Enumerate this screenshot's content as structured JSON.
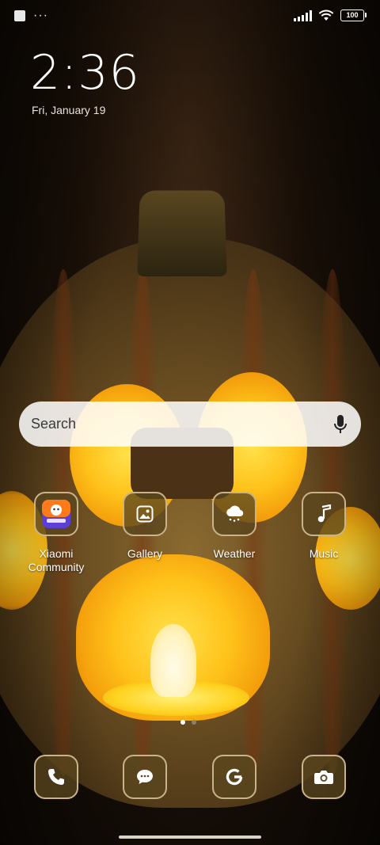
{
  "status_bar": {
    "notification_icon": "square-icon",
    "more_indicator": "···",
    "battery_level": "100",
    "signal": "cellular-signal-icon",
    "wifi": "wifi-icon"
  },
  "clock": {
    "time": "2:36",
    "date": "Fri, January 19"
  },
  "search": {
    "placeholder": "Search",
    "mic_icon": "mic-icon"
  },
  "apps": [
    {
      "label": "Xiaomi Community",
      "icon": "xiaomi-community-icon"
    },
    {
      "label": "Gallery",
      "icon": "gallery-icon"
    },
    {
      "label": "Weather",
      "icon": "weather-icon"
    },
    {
      "label": "Music",
      "icon": "music-icon"
    }
  ],
  "page_indicator": {
    "total": 2,
    "active": 1
  },
  "dock": [
    {
      "name": "Phone",
      "icon": "phone-icon"
    },
    {
      "name": "Messages",
      "icon": "message-icon"
    },
    {
      "name": "Google",
      "icon": "google-icon"
    },
    {
      "name": "Camera",
      "icon": "camera-icon"
    }
  ],
  "colors": {
    "icon_border": "#c9b38a",
    "icon_bg": "#5a461e",
    "active_dot": "#ffffff",
    "inactive_dot": "#8a8070"
  }
}
